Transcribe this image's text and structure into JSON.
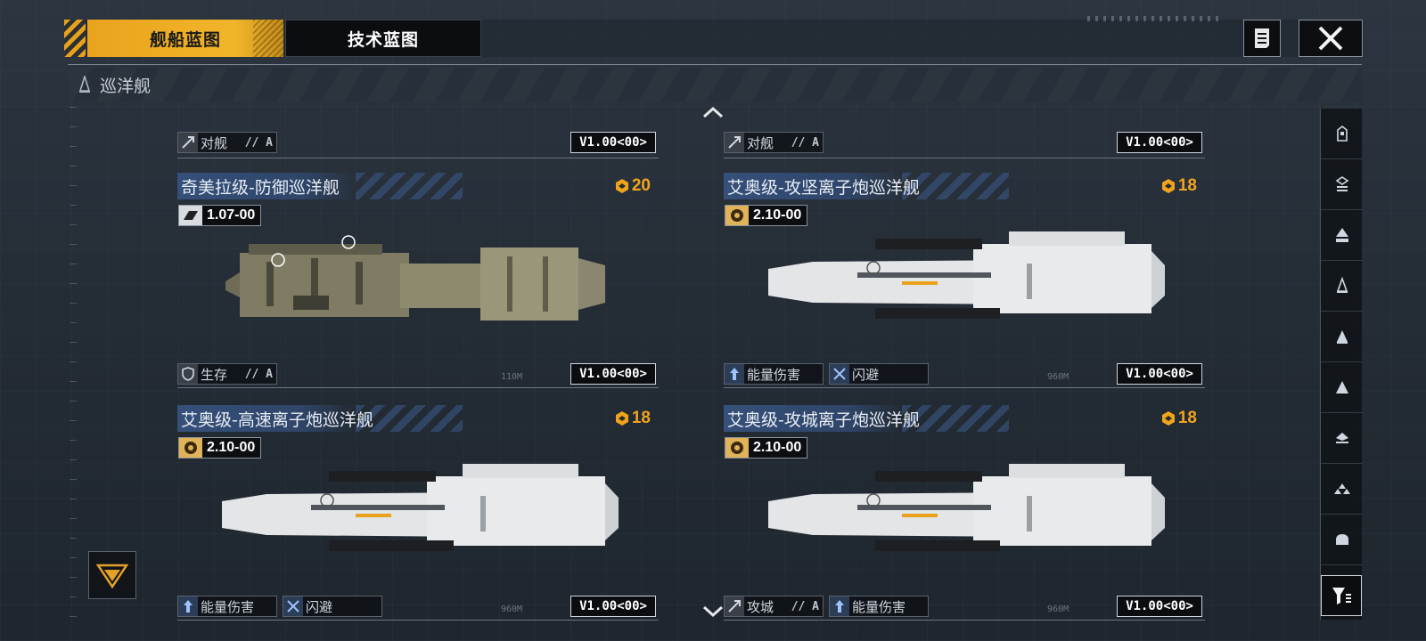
{
  "tabs": [
    {
      "label": "舰船蓝图",
      "active": true
    },
    {
      "label": "技术蓝图",
      "active": false
    }
  ],
  "category": {
    "icon": "cruiser-class-icon",
    "label": "巡洋舰"
  },
  "partial_top_row": [
    {
      "tag": {
        "icon": "anti-ship-icon",
        "label": "对舰",
        "sub": "// A"
      },
      "version": "V1.00<00>"
    },
    {
      "tag": {
        "icon": "anti-ship-icon",
        "label": "对舰",
        "sub": "// A"
      },
      "version": "V1.00<00>"
    }
  ],
  "ships": [
    {
      "name": "奇美拉级-防御巡洋舰",
      "cost": "20",
      "badge_value": "1.07-00",
      "scale_label": "110M",
      "tags": [
        {
          "icon": "survival-icon",
          "label": "生存",
          "sub": "// A"
        }
      ],
      "version": "V1.00<00>",
      "hull_color": "#8d8a6f"
    },
    {
      "name": "艾奥级-攻坚离子炮巡洋舰",
      "cost": "18",
      "badge_value": "2.10-00",
      "scale_label": "960M",
      "tags": [
        {
          "icon": "energy-damage-icon",
          "label": "能量伤害",
          "sub": ""
        },
        {
          "icon": "evasion-icon",
          "label": "闪避",
          "sub": ""
        }
      ],
      "version": "V1.00<00>",
      "hull_color": "#e3e5e7"
    },
    {
      "name": "艾奥级-高速离子炮巡洋舰",
      "cost": "18",
      "badge_value": "2.10-00",
      "scale_label": "960M",
      "tags": [
        {
          "icon": "energy-damage-icon",
          "label": "能量伤害",
          "sub": ""
        },
        {
          "icon": "evasion-icon",
          "label": "闪避",
          "sub": ""
        }
      ],
      "version": "V1.00<00>",
      "hull_color": "#e3e5e7"
    },
    {
      "name": "艾奥级-攻城离子炮巡洋舰",
      "cost": "18",
      "badge_value": "2.10-00",
      "scale_label": "960M",
      "tags": [
        {
          "icon": "siege-icon",
          "label": "攻城",
          "sub": "// A"
        },
        {
          "icon": "energy-damage-icon",
          "label": "能量伤害",
          "sub": ""
        }
      ],
      "version": "V1.00<00>",
      "hull_color": "#e3e5e7"
    }
  ],
  "sidebar_filters": [
    "class-filter-1-icon",
    "class-filter-2-icon",
    "class-filter-3-icon",
    "cruiser-filter-icon",
    "class-filter-5-icon",
    "class-filter-6-icon",
    "class-filter-7-icon",
    "class-filter-8-icon",
    "class-filter-9-icon"
  ],
  "colors": {
    "accent": "#f0a41e",
    "name_bar": "#35507a",
    "background": "#263039"
  }
}
